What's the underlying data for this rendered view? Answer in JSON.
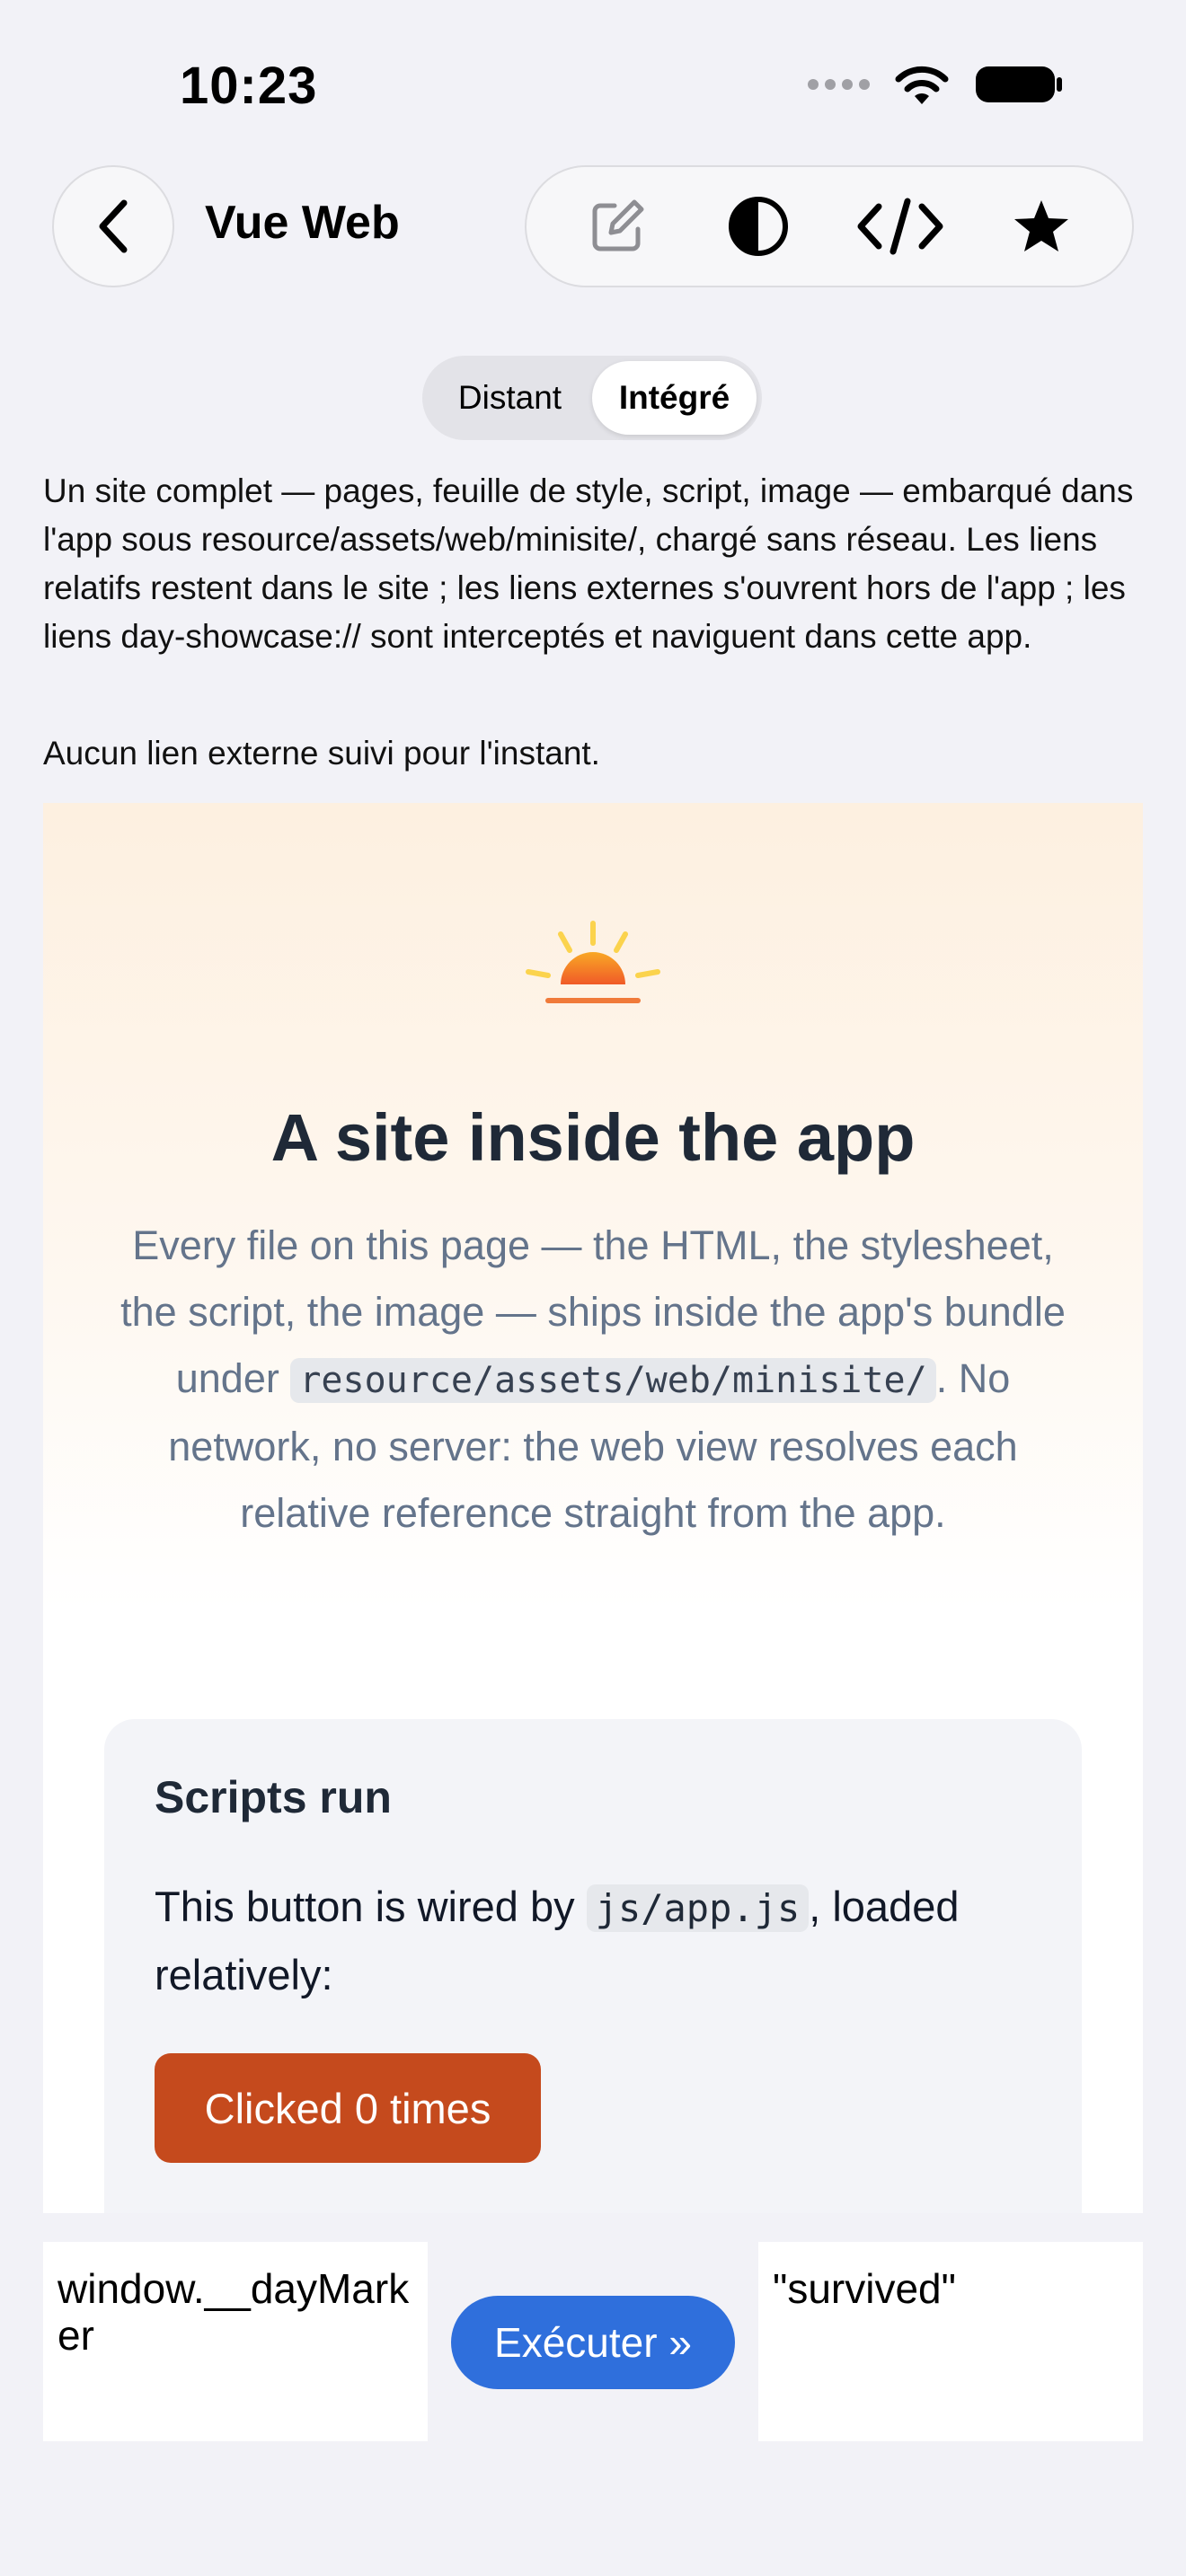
{
  "status_bar": {
    "time": "10:23",
    "icons": [
      "signal-dots-icon",
      "wifi-icon",
      "battery-icon"
    ]
  },
  "nav": {
    "back_icon": "chevron-left-icon",
    "title": "Vue Web",
    "toolbar_icons": [
      "edit-icon",
      "contrast-icon",
      "code-icon",
      "star-icon"
    ]
  },
  "segmented": {
    "options": [
      "Distant",
      "Intégré"
    ],
    "selected": "Intégré"
  },
  "description": "Un site complet — pages, feuille de style, script, image — embarqué dans l'app sous resource/assets/web/minisite/, chargé sans réseau. Les liens relatifs restent dans le site ; les liens externes s'ouvrent hors de l'app ; les liens day-showcase:// sont interceptés et naviguent dans cette app.",
  "external_note": "Aucun lien externe suivi pour l'instant.",
  "webview": {
    "title": "A site inside the app",
    "intro_before": "Every file on this page — the HTML, the stylesheet, the script, the image — ships inside the app's bundle under ",
    "intro_code": "resource/assets/web/minisite/",
    "intro_after": ". No network, no server: the web view resolves each relative reference straight from the app.",
    "card": {
      "title": "Scripts run",
      "text_before": "This button is wired by ",
      "text_code": "js/app.js",
      "text_after": ", loaded relatively:",
      "button_label": "Clicked 0 times"
    },
    "colors": {
      "button": "#c54a1d",
      "title": "#1f2937",
      "intro": "#64748b"
    }
  },
  "runner": {
    "input_value": "window.__dayMarker",
    "run_label": "Exécuter »",
    "output_value": "\"survived\""
  },
  "accent_color": "#2f6fdc"
}
